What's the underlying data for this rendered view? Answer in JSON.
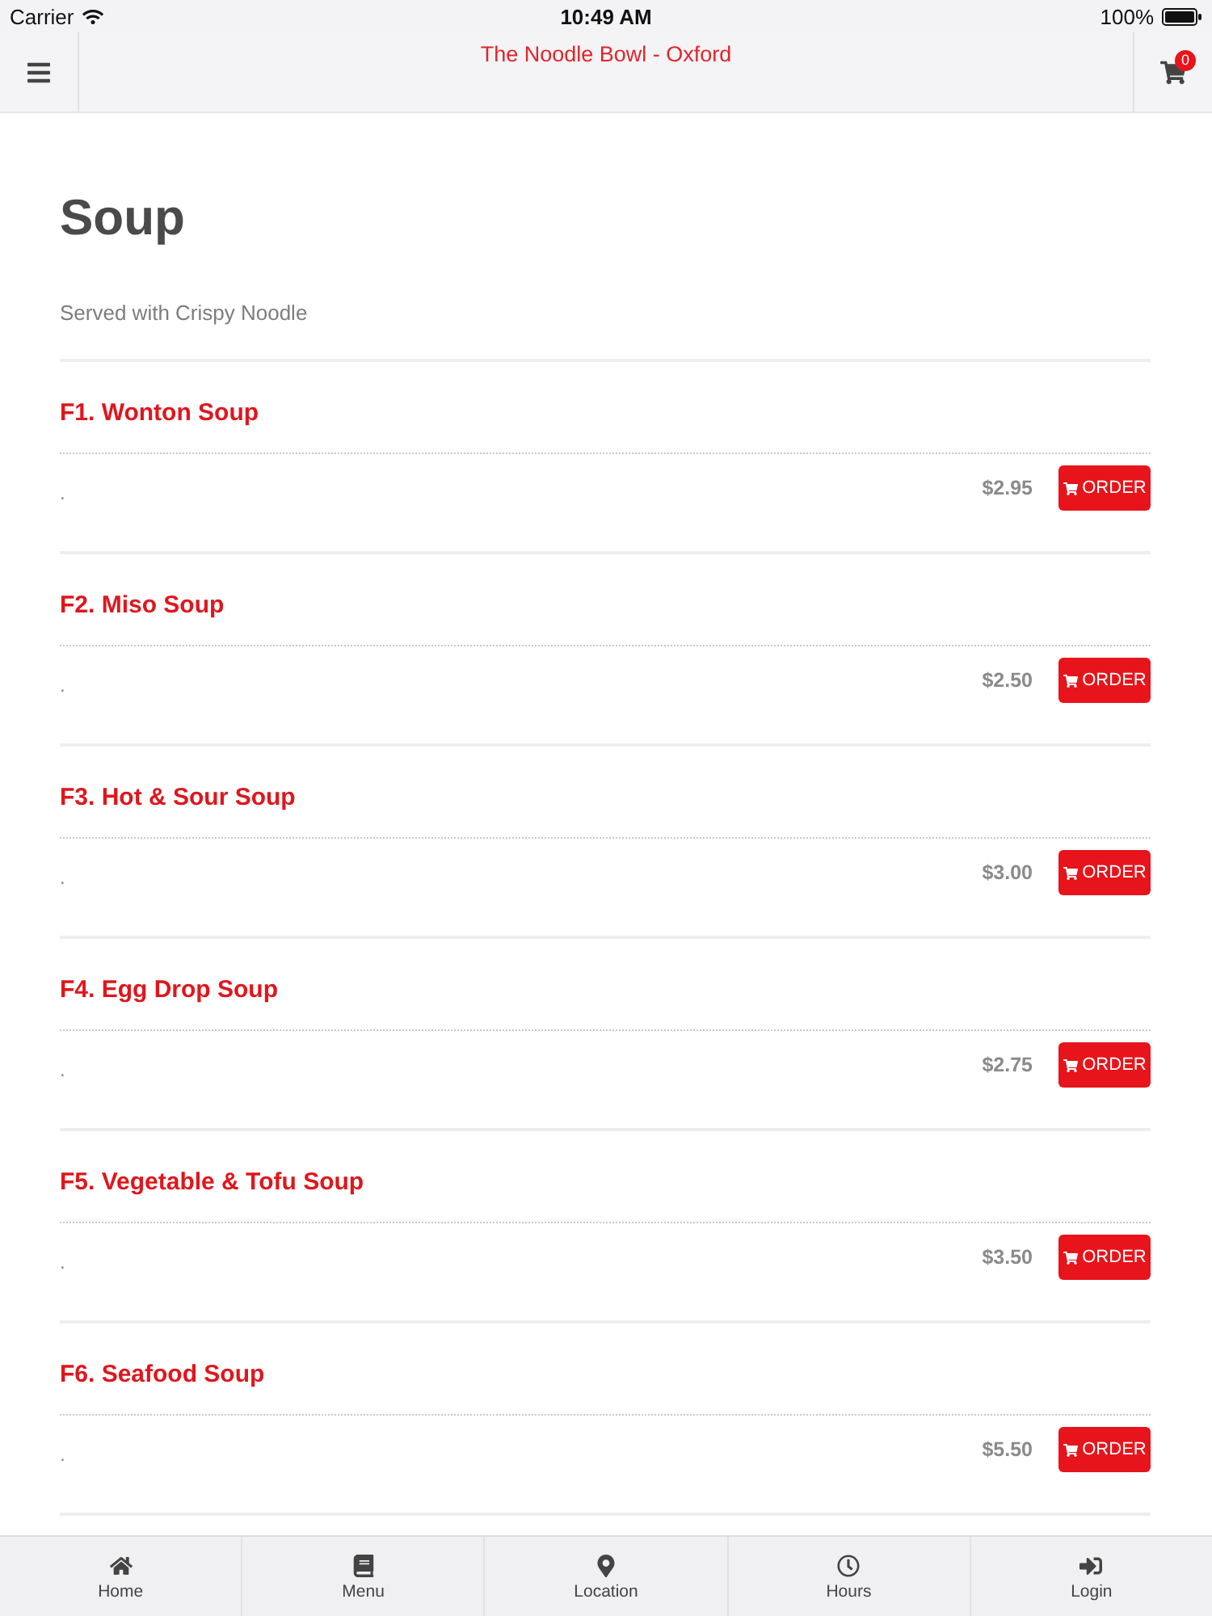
{
  "status_bar": {
    "carrier": "Carrier",
    "time": "10:49 AM",
    "battery": "100%"
  },
  "nav_bar": {
    "title": "The Noodle Bowl - Oxford",
    "cart_count": "0"
  },
  "section": {
    "title": "Soup",
    "subtitle": "Served with Crispy Noodle"
  },
  "items": [
    {
      "name": "F1. Wonton Soup",
      "description": ".",
      "price": "$2.95",
      "button": "ORDER"
    },
    {
      "name": "F2. Miso Soup",
      "description": ".",
      "price": "$2.50",
      "button": "ORDER"
    },
    {
      "name": "F3. Hot & Sour Soup",
      "description": ".",
      "price": "$3.00",
      "button": "ORDER"
    },
    {
      "name": "F4. Egg Drop Soup",
      "description": ".",
      "price": "$2.75",
      "button": "ORDER"
    },
    {
      "name": "F5. Vegetable & Tofu Soup",
      "description": ".",
      "price": "$3.50",
      "button": "ORDER"
    },
    {
      "name": "F6. Seafood Soup",
      "description": ".",
      "price": "$5.50",
      "button": "ORDER"
    }
  ],
  "tab_bar": [
    {
      "label": "Home"
    },
    {
      "label": "Menu"
    },
    {
      "label": "Location"
    },
    {
      "label": "Hours"
    },
    {
      "label": "Login"
    }
  ]
}
